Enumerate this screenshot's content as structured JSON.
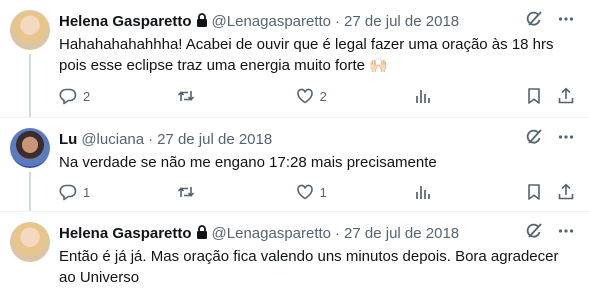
{
  "tweets": [
    {
      "name": "Helena Gasparetto",
      "handle": "@Lenagasparetto",
      "dot": "·",
      "date": "27 de jul de 2018",
      "locked": true,
      "avatar": "avatar-helena",
      "text": "Hahahahahahhha! Acabei de ouvir que é legal fazer uma oração às 18 hrs pois esse eclipse traz uma energia muito forte 🙌🏻",
      "replies": "2",
      "retweets": "",
      "likes": "2"
    },
    {
      "name": "Lu",
      "handle": "@luciana",
      "dot": "·",
      "date": "27 de jul de 2018",
      "locked": false,
      "avatar": "avatar-lu",
      "text": "Na verdade se não me engano 17:28 mais precisamente",
      "replies": "1",
      "retweets": "",
      "likes": "1"
    },
    {
      "name": "Helena Gasparetto",
      "handle": "@Lenagasparetto",
      "dot": "·",
      "date": "27 de jul de 2018",
      "locked": true,
      "avatar": "avatar-helena",
      "text": "Então é já já. Mas oração fica valendo uns minutos depois. Bora agradecer ao Universo"
    }
  ],
  "icons": {
    "grok": "grok-icon",
    "more": "more-icon",
    "lock": "lock-icon",
    "reply": "reply-icon",
    "retweet": "retweet-icon",
    "like": "like-icon",
    "views": "views-icon",
    "bookmark": "bookmark-icon",
    "share": "share-icon"
  },
  "colors": {
    "text": "#0f1419",
    "secondary": "#536471",
    "divider": "#eff3f4",
    "thread_line": "#cfd9de"
  }
}
